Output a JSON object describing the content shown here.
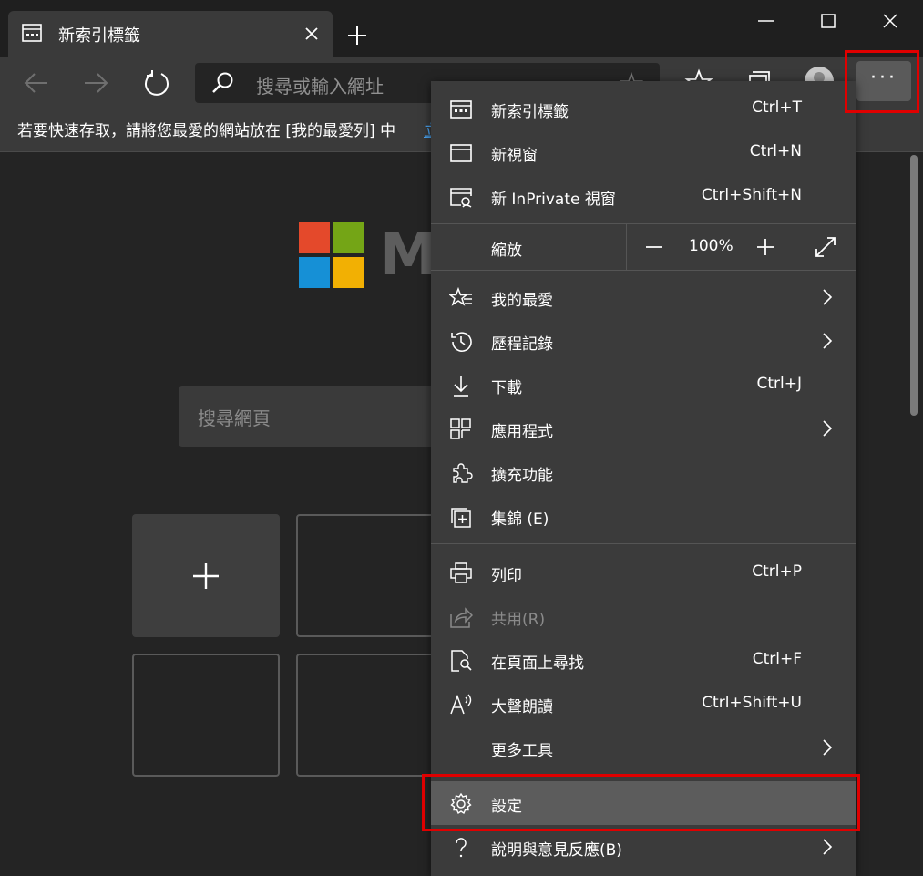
{
  "tab": {
    "title": "新索引標籤"
  },
  "address_bar": {
    "placeholder": "搜尋或輸入網址"
  },
  "favorites_bar": {
    "message": "若要快速存取，請將您最愛的網站放在 [我的最愛列] 中",
    "link": "立"
  },
  "new_tab_page": {
    "logo_text": "M",
    "search_placeholder": "搜尋網頁"
  },
  "menu": {
    "items_top": [
      {
        "label": "新索引標籤",
        "shortcut": "Ctrl+T",
        "icon": "tab-icon"
      },
      {
        "label": "新視窗",
        "shortcut": "Ctrl+N",
        "icon": "window-icon"
      },
      {
        "label": "新 InPrivate 視窗",
        "shortcut": "Ctrl+Shift+N",
        "icon": "inprivate-icon"
      }
    ],
    "zoom": {
      "label": "縮放",
      "value": "100%",
      "minus": "−",
      "plus": "+"
    },
    "items_mid": [
      {
        "label": "我的最愛",
        "shortcut": "",
        "icon": "favorites-icon"
      },
      {
        "label": "歷程記錄",
        "shortcut": "",
        "icon": "history-icon"
      },
      {
        "label": "下載",
        "shortcut": "Ctrl+J",
        "icon": "download-icon"
      },
      {
        "label": "應用程式",
        "shortcut": "",
        "icon": "apps-icon"
      },
      {
        "label": "擴充功能",
        "shortcut": "",
        "icon": "extensions-icon"
      },
      {
        "label": "集錦 (E)",
        "shortcut": "",
        "icon": "collections-icon"
      }
    ],
    "items_low": [
      {
        "label": "列印",
        "shortcut": "Ctrl+P",
        "icon": "print-icon"
      },
      {
        "label": "共用(R)",
        "shortcut": "",
        "icon": "share-icon"
      },
      {
        "label": "在頁面上尋找",
        "shortcut": "Ctrl+F",
        "icon": "find-icon"
      },
      {
        "label": "大聲朗讀",
        "shortcut": "Ctrl+Shift+U",
        "icon": "read-aloud-icon"
      },
      {
        "label": "更多工具",
        "shortcut": "",
        "icon": ""
      }
    ],
    "items_bottom": [
      {
        "label": "設定",
        "shortcut": "",
        "icon": "gear-icon"
      },
      {
        "label": "說明與意見反應(B)",
        "shortcut": "",
        "icon": "help-icon"
      }
    ]
  },
  "colors": {
    "highlight": "#e00000",
    "menu_bg": "#3b3b3b",
    "hover": "#5c5c5c"
  }
}
